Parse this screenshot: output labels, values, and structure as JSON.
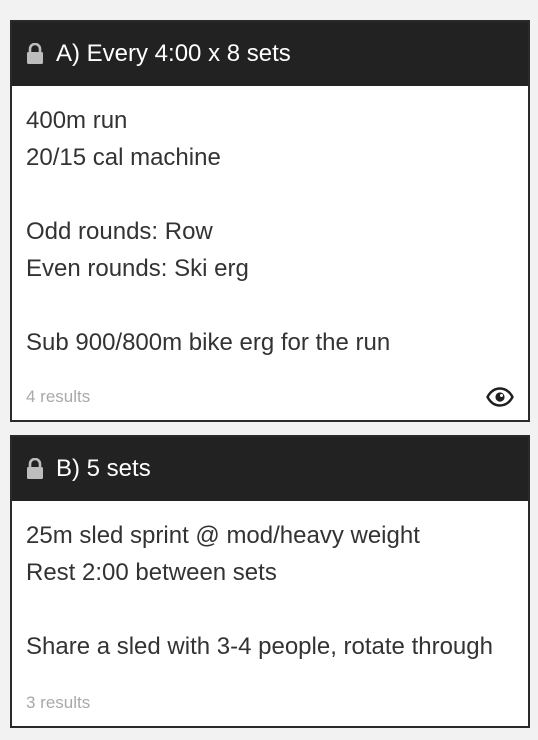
{
  "cards": [
    {
      "title": "A) Every 4:00 x 8 sets",
      "lines": [
        "400m run",
        "20/15 cal machine",
        "",
        "Odd rounds: Row",
        "Even rounds: Ski erg",
        "",
        "Sub 900/800m bike erg for the run"
      ],
      "results": "4 results",
      "icons": [
        "lock-icon",
        "eye-icon"
      ]
    },
    {
      "title": "B) 5 sets",
      "lines": [
        "25m sled sprint @ mod/heavy weight",
        "Rest 2:00 between sets",
        "",
        "Share a sled with 3-4 people, rotate through"
      ],
      "results": "3 results",
      "icons": [
        "lock-icon"
      ]
    }
  ],
  "colors": {
    "header_bg": "#222222",
    "border": "#2a2a2a",
    "body_text": "#333333",
    "muted_text": "#a9a9a9"
  }
}
